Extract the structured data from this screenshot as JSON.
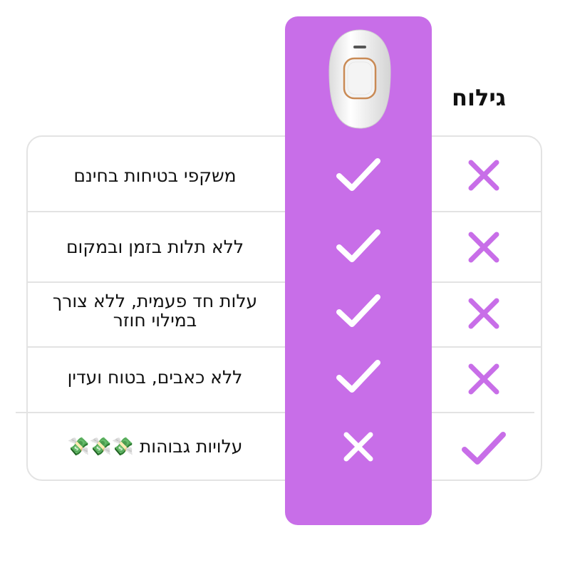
{
  "header": {
    "shaving_label": "גילוח"
  },
  "product": {
    "image_icon": "ipl-hair-removal-device-icon",
    "accent_color": "#c86ee8"
  },
  "rows": [
    {
      "label": "משקפי בטיחות בחינם",
      "product": "check",
      "shaving": "cross"
    },
    {
      "label": "ללא תלות בזמן ובמקום",
      "product": "check",
      "shaving": "cross"
    },
    {
      "label": "עלות חד פעמית, ללא צורך\nבמילוי חוזר",
      "product": "check",
      "shaving": "cross"
    },
    {
      "label": "ללא כאבים, בטוח ועדין",
      "product": "check",
      "shaving": "cross"
    },
    {
      "label": "עלויות גבוהות 💸💸💸",
      "product": "cross",
      "shaving": "check"
    }
  ],
  "colors": {
    "purple": "#c86ee8",
    "white": "#ffffff",
    "border": "#e3e3e3",
    "text": "#111111"
  }
}
